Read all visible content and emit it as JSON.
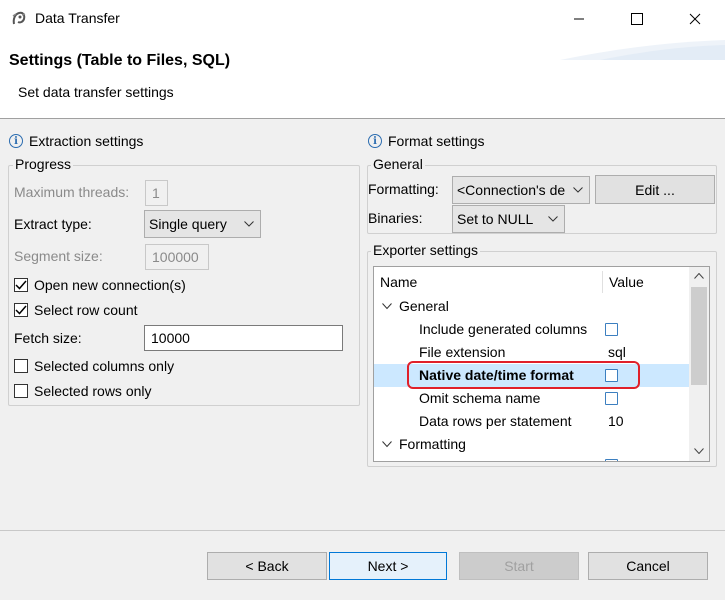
{
  "window": {
    "title": "Data Transfer"
  },
  "header": {
    "title": "Settings (Table to Files, SQL)",
    "subtitle": "Set data transfer settings"
  },
  "extraction": {
    "heading": "Extraction settings",
    "group_title": "Progress",
    "max_threads_label": "Maximum threads:",
    "max_threads_value": "1",
    "extract_type_label": "Extract type:",
    "extract_type_value": "Single query",
    "segment_size_label": "Segment size:",
    "segment_size_value": "100000",
    "open_new_connection_label": "Open new connection(s)",
    "select_row_count_label": "Select row count",
    "fetch_size_label": "Fetch size:",
    "fetch_size_value": "10000",
    "selected_columns_label": "Selected columns only",
    "selected_rows_label": "Selected rows only"
  },
  "format": {
    "heading": "Format settings",
    "general_title": "General",
    "formatting_label": "Formatting:",
    "formatting_value": "<Connection's de",
    "edit_button": "Edit ...",
    "binaries_label": "Binaries:",
    "binaries_value": "Set to NULL",
    "exporter_title": "Exporter settings",
    "table": {
      "col_name": "Name",
      "col_value": "Value",
      "group_general": "General",
      "group_formatting": "Formatting",
      "rows": [
        {
          "name": "Include generated columns",
          "value": ""
        },
        {
          "name": "File extension",
          "value": "sql"
        },
        {
          "name": "Native date/time format",
          "value": ""
        },
        {
          "name": "Omit schema name",
          "value": ""
        },
        {
          "name": "Data rows per statement",
          "value": "10"
        }
      ]
    }
  },
  "footer": {
    "back": "< Back",
    "next": "Next >",
    "start": "Start",
    "cancel": "Cancel"
  },
  "colors": {
    "accent": "#0078d7",
    "selection": "#cce8ff",
    "highlight_box": "#e0202a"
  }
}
